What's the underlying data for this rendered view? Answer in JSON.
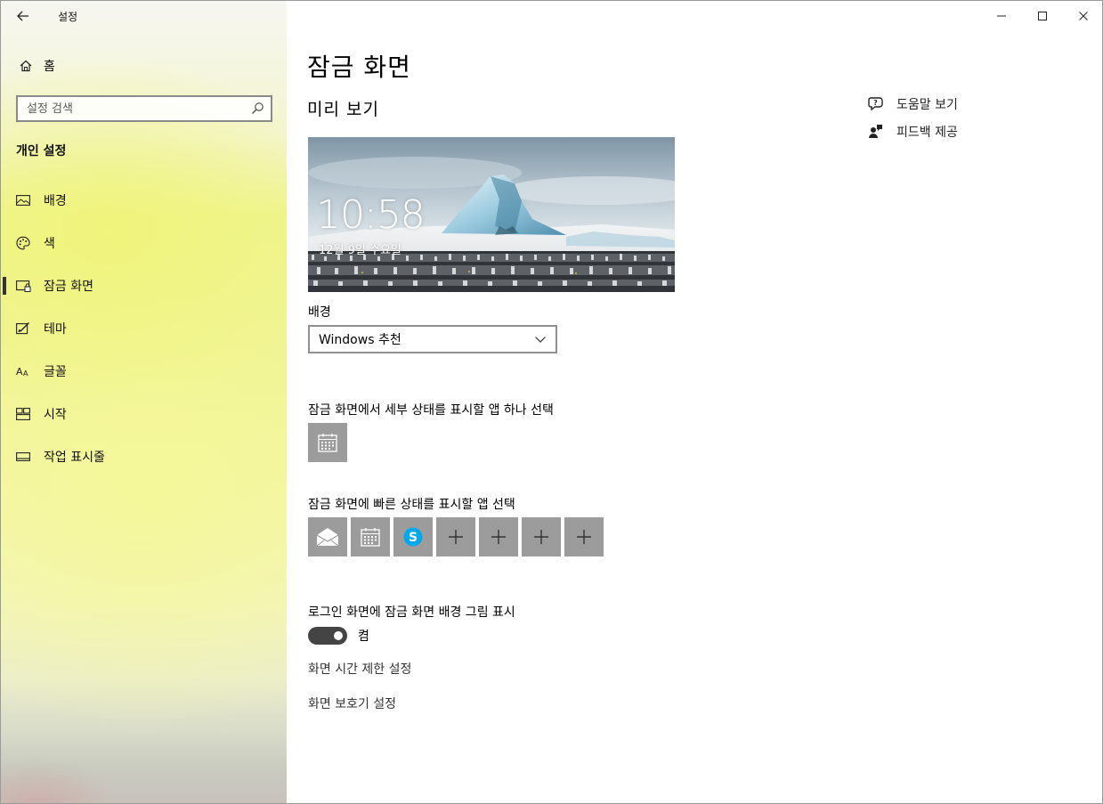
{
  "window": {
    "app_title": "설정"
  },
  "sidebar": {
    "home_label": "홈",
    "search_placeholder": "설정 검색",
    "section_title": "개인 설정",
    "items": [
      {
        "label": "배경",
        "icon": "picture-icon",
        "active": false
      },
      {
        "label": "색",
        "icon": "palette-icon",
        "active": false
      },
      {
        "label": "잠금 화면",
        "icon": "lock-screen-icon",
        "active": true
      },
      {
        "label": "테마",
        "icon": "theme-icon",
        "active": false
      },
      {
        "label": "글꼴",
        "icon": "font-icon",
        "active": false
      },
      {
        "label": "시작",
        "icon": "start-icon",
        "active": false
      },
      {
        "label": "작업 표시줄",
        "icon": "taskbar-icon",
        "active": false
      }
    ]
  },
  "main": {
    "page_title": "잠금 화면",
    "preview_title": "미리 보기",
    "preview": {
      "time": "10:58",
      "date": "12월 9일 수요일"
    },
    "background_label": "배경",
    "background_value": "Windows 추천",
    "detailed_status_label": "잠금 화면에서 세부 상태를 표시할 앱 하나 선택",
    "quick_status_label": "잠금 화면에 빠른 상태를 표시할 앱 선택",
    "signin_bg_label": "로그인 화면에 잠금 화면 배경 그림 표시",
    "signin_bg_state": "켬",
    "signin_bg_on": true,
    "link_timeout": "화면 시간 제한 설정",
    "link_screensaver": "화면 보호기 설정"
  },
  "help": {
    "get_help": "도움말 보기",
    "feedback": "피드백 제공"
  },
  "colors": {
    "tile": "#9c9c9c",
    "toggle_on": "#444444",
    "skype": "#00a9ec"
  }
}
